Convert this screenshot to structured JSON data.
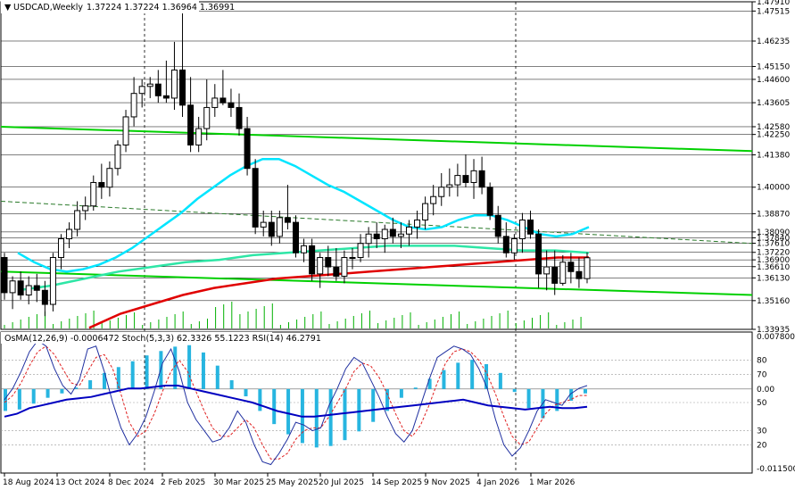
{
  "header": {
    "symbol": "USDCAD,Weekly",
    "ohlc": "1.37224 1.37224 1.36964 1.36991",
    "indicators": "OsMA(12,26,9) -0.0006472  Stoch(5,3,3) 62.3326 55.1223  RSI(14) 46.2791"
  },
  "colors": {
    "candle": "#000000",
    "ma_fast": "#00e5ff",
    "ma_mid": "#2ee6a6",
    "ma_slow": "#e00000",
    "channel": "#00d000",
    "osma_bar": "#27b5e0",
    "stoch_main": "#2030a0",
    "stoch_signal": "#e02020",
    "rsi": "#0000c0"
  },
  "chart_data": [
    {
      "type": "candlestick",
      "title": "USDCAD,Weekly",
      "ylim": [
        1.33935,
        1.4791
      ],
      "price_labels": [
        "1.47910",
        "1.47515",
        "1.46235",
        "1.45150",
        "1.44600",
        "1.43605",
        "1.42580",
        "1.42250",
        "1.41380",
        "1.40000",
        "1.38870",
        "1.38090",
        "1.37840",
        "1.37610",
        "1.37220",
        "1.36900",
        "1.36610",
        "1.36130",
        "1.35160",
        "1.33935"
      ],
      "x_labels": [
        "18 Aug 2024",
        "13 Oct 2024",
        "8 Dec 2024",
        "2 Feb 2025",
        "30 Mar 2025",
        "25 May 2025",
        "20 Jul 2025",
        "14 Sep 2025",
        "9 Nov 2025",
        "4 Jan 2026",
        "1 Mar 2026"
      ],
      "candles": [
        [
          1.37,
          1.372,
          1.352,
          1.355
        ],
        [
          1.355,
          1.362,
          1.348,
          1.36
        ],
        [
          1.36,
          1.364,
          1.352,
          1.354
        ],
        [
          1.354,
          1.362,
          1.35,
          1.358
        ],
        [
          1.358,
          1.363,
          1.351,
          1.356
        ],
        [
          1.356,
          1.36,
          1.345,
          1.35
        ],
        [
          1.35,
          1.372,
          1.347,
          1.37
        ],
        [
          1.37,
          1.38,
          1.365,
          1.378
        ],
        [
          1.378,
          1.385,
          1.374,
          1.382
        ],
        [
          1.382,
          1.394,
          1.379,
          1.39
        ],
        [
          1.39,
          1.396,
          1.386,
          1.392
        ],
        [
          1.392,
          1.405,
          1.39,
          1.402
        ],
        [
          1.402,
          1.41,
          1.395,
          1.4
        ],
        [
          1.4,
          1.411,
          1.396,
          1.408
        ],
        [
          1.408,
          1.42,
          1.405,
          1.418
        ],
        [
          1.418,
          1.433,
          1.415,
          1.43
        ],
        [
          1.43,
          1.447,
          1.426,
          1.44
        ],
        [
          1.44,
          1.446,
          1.434,
          1.443
        ],
        [
          1.443,
          1.447,
          1.438,
          1.444
        ],
        [
          1.444,
          1.45,
          1.436,
          1.439
        ],
        [
          1.439,
          1.454,
          1.436,
          1.438
        ],
        [
          1.438,
          1.462,
          1.433,
          1.45
        ],
        [
          1.45,
          1.4791,
          1.43,
          1.435
        ],
        [
          1.435,
          1.447,
          1.415,
          1.418
        ],
        [
          1.418,
          1.43,
          1.415,
          1.425
        ],
        [
          1.425,
          1.446,
          1.42,
          1.434
        ],
        [
          1.434,
          1.444,
          1.43,
          1.438
        ],
        [
          1.438,
          1.45,
          1.435,
          1.436
        ],
        [
          1.436,
          1.442,
          1.43,
          1.434
        ],
        [
          1.434,
          1.44,
          1.422,
          1.425
        ],
        [
          1.425,
          1.43,
          1.405,
          1.408
        ],
        [
          1.408,
          1.412,
          1.38,
          1.383
        ],
        [
          1.383,
          1.39,
          1.379,
          1.385
        ],
        [
          1.385,
          1.39,
          1.375,
          1.379
        ],
        [
          1.379,
          1.39,
          1.376,
          1.387
        ],
        [
          1.387,
          1.401,
          1.382,
          1.385
        ],
        [
          1.385,
          1.388,
          1.37,
          1.372
        ],
        [
          1.372,
          1.378,
          1.368,
          1.375
        ],
        [
          1.375,
          1.378,
          1.36,
          1.363
        ],
        [
          1.363,
          1.372,
          1.357,
          1.37
        ],
        [
          1.37,
          1.375,
          1.362,
          1.366
        ],
        [
          1.366,
          1.374,
          1.36,
          1.362
        ],
        [
          1.362,
          1.373,
          1.359,
          1.37
        ],
        [
          1.37,
          1.374,
          1.365,
          1.37
        ],
        [
          1.37,
          1.38,
          1.368,
          1.376
        ],
        [
          1.376,
          1.383,
          1.37,
          1.38
        ],
        [
          1.38,
          1.385,
          1.374,
          1.378
        ],
        [
          1.378,
          1.384,
          1.372,
          1.382
        ],
        [
          1.382,
          1.387,
          1.376,
          1.379
        ],
        [
          1.379,
          1.385,
          1.374,
          1.38
        ],
        [
          1.38,
          1.386,
          1.375,
          1.383
        ],
        [
          1.383,
          1.39,
          1.378,
          1.386
        ],
        [
          1.386,
          1.396,
          1.382,
          1.393
        ],
        [
          1.393,
          1.401,
          1.388,
          1.396
        ],
        [
          1.396,
          1.406,
          1.392,
          1.4
        ],
        [
          1.4,
          1.408,
          1.396,
          1.401
        ],
        [
          1.401,
          1.41,
          1.396,
          1.405
        ],
        [
          1.405,
          1.414,
          1.4,
          1.402
        ],
        [
          1.402,
          1.412,
          1.395,
          1.407
        ],
        [
          1.407,
          1.413,
          1.397,
          1.4
        ],
        [
          1.4,
          1.402,
          1.386,
          1.388
        ],
        [
          1.388,
          1.392,
          1.376,
          1.379
        ],
        [
          1.379,
          1.385,
          1.37,
          1.372
        ],
        [
          1.372,
          1.38,
          1.369,
          1.378
        ],
        [
          1.378,
          1.389,
          1.372,
          1.386
        ],
        [
          1.386,
          1.39,
          1.378,
          1.38
        ],
        [
          1.38,
          1.382,
          1.357,
          1.363
        ],
        [
          1.363,
          1.373,
          1.356,
          1.366
        ],
        [
          1.366,
          1.373,
          1.354,
          1.359
        ],
        [
          1.359,
          1.371,
          1.358,
          1.368
        ],
        [
          1.368,
          1.372,
          1.359,
          1.364
        ],
        [
          1.364,
          1.37,
          1.357,
          1.361
        ],
        [
          1.361,
          1.3722,
          1.359,
          1.3699
        ]
      ],
      "ma_fast": [
        1.372,
        1.368,
        1.365,
        1.364,
        1.365,
        1.367,
        1.37,
        1.374,
        1.379,
        1.384,
        1.389,
        1.395,
        1.4,
        1.405,
        1.409,
        1.412,
        1.412,
        1.409,
        1.405,
        1.401,
        1.398,
        1.394,
        1.39,
        1.386,
        1.383,
        1.382,
        1.383,
        1.386,
        1.388,
        1.388,
        1.386,
        1.383,
        1.38,
        1.379,
        1.38,
        1.383
      ],
      "ma_mid": [
        1.356,
        1.358,
        1.361,
        1.364,
        1.366,
        1.368,
        1.369,
        1.371,
        1.372,
        1.373,
        1.374,
        1.375,
        1.375,
        1.375,
        1.374,
        1.373,
        1.373,
        1.372
      ],
      "ma_slow": [
        1.34,
        1.346,
        1.35,
        1.354,
        1.357,
        1.359,
        1.361,
        1.362,
        1.363,
        1.364,
        1.365,
        1.366,
        1.367,
        1.368,
        1.369,
        1.37,
        1.37
      ],
      "channel_upper": [
        1.4258,
        1.4154
      ],
      "channel_lower": [
        1.364,
        1.354
      ],
      "trend_line": [
        1.394,
        1.376
      ]
    },
    {
      "type": "bar",
      "title": "OsMA(12,26,9) -0.0006472",
      "ylim": [
        -0.0115,
        0.0078
      ],
      "ylim_labels": [
        "0.007800",
        "-0.011500"
      ],
      "values": [
        -0.003,
        -0.0028,
        -0.002,
        -0.0012,
        -0.0006,
        0.0002,
        0.0012,
        0.0022,
        0.003,
        0.0038,
        0.0046,
        0.0052,
        0.0058,
        0.006,
        0.005,
        0.0032,
        0.0012,
        -0.001,
        -0.003,
        -0.0048,
        -0.0062,
        -0.0074,
        -0.008,
        -0.0078,
        -0.007,
        -0.0058,
        -0.0045,
        -0.003,
        -0.0012,
        0.0002,
        0.0014,
        0.0026,
        0.0036,
        0.004,
        0.0034,
        0.0022,
        -0.0004,
        -0.0026,
        -0.004,
        -0.003,
        -0.0016,
        -0.0006
      ]
    },
    {
      "type": "line",
      "title": "Stoch(5,3,3) 62.3326 55.1223",
      "ylim": [
        0,
        100
      ],
      "levels": [
        "80",
        "70",
        "50",
        "30",
        "20"
      ],
      "main": [
        52,
        60,
        72,
        86,
        94,
        90,
        74,
        62,
        56,
        66,
        88,
        90,
        72,
        50,
        32,
        20,
        28,
        40,
        58,
        78,
        88,
        72,
        50,
        38,
        30,
        22,
        24,
        32,
        44,
        36,
        20,
        8,
        6,
        14,
        24,
        36,
        34,
        30,
        32,
        48,
        60,
        74,
        82,
        78,
        66,
        54,
        40,
        28,
        22,
        30,
        48,
        66,
        82,
        86,
        90,
        88,
        84,
        74,
        60,
        38,
        20,
        12,
        18,
        30,
        44,
        52,
        50,
        48,
        56,
        60,
        62
      ],
      "signal": [
        50,
        55,
        64,
        76,
        86,
        90,
        84,
        74,
        64,
        62,
        72,
        82,
        84,
        74,
        56,
        36,
        26,
        30,
        42,
        58,
        72,
        80,
        72,
        58,
        44,
        32,
        26,
        26,
        32,
        38,
        32,
        20,
        10,
        10,
        14,
        24,
        30,
        32,
        32,
        40,
        50,
        60,
        72,
        78,
        76,
        68,
        56,
        42,
        30,
        26,
        34,
        48,
        64,
        78,
        86,
        88,
        86,
        80,
        70,
        56,
        40,
        26,
        20,
        22,
        32,
        42,
        48,
        50,
        52,
        55,
        55
      ]
    },
    {
      "type": "line",
      "title": "RSI(14) 46.2791",
      "ylim": [
        0,
        100
      ],
      "values": [
        40,
        42,
        46,
        48,
        50,
        52,
        53,
        54,
        56,
        58,
        60,
        60,
        61,
        62,
        62,
        60,
        58,
        56,
        54,
        52,
        50,
        47,
        44,
        42,
        40,
        40,
        41,
        42,
        43,
        44,
        45,
        46,
        47,
        48,
        49,
        50,
        51,
        52,
        50,
        48,
        47,
        46,
        45,
        46,
        47,
        46,
        46,
        47
      ]
    }
  ]
}
